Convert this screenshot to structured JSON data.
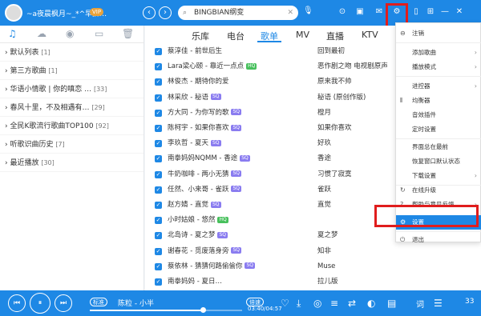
{
  "titlebar": {
    "username": "~a夜晨枫月~_*^早拼…",
    "vip": "VIP",
    "nav_back": "‹",
    "nav_forward": "›",
    "search_value": "BINGBIAN纲变",
    "icons": [
      "⊙",
      "▣",
      "✉",
      "⚙",
      "▯",
      "⊞",
      "—",
      "✕"
    ]
  },
  "left_tabs": [
    "♫",
    "☁",
    "◉",
    "▭",
    "🗑"
  ],
  "playlists": [
    {
      "label": "› 默认列表",
      "count": "[1]"
    },
    {
      "label": "› 第三方歌曲",
      "count": "[1]"
    },
    {
      "label": "› 华语小情歌 | 你的嗔恋 …",
      "count": "[33]"
    },
    {
      "label": "› 春风十里，不及相遇有…",
      "count": "[29]"
    },
    {
      "label": "› 全民K歌流行歌曲TOP100",
      "count": "[92]"
    },
    {
      "label": "› 听歌识曲历史",
      "count": "[7]"
    },
    {
      "label": "› 最近播放",
      "count": "[30]"
    }
  ],
  "tabs": [
    "乐库",
    "电台",
    "歌单",
    "MV",
    "直播",
    "KTV"
  ],
  "active_tab": 2,
  "songs": [
    {
      "title": "蔡淳佳 - 前世后生",
      "tag": "",
      "album": "回到最初"
    },
    {
      "title": "Lara梁心颐 - 靠近一点点",
      "tag": "HQ",
      "album": "恶作剧之吻 电视剧原声"
    },
    {
      "title": "林俊杰 - 期待你的爱",
      "tag": "",
      "album": "原来我不帅"
    },
    {
      "title": "林采欣 - 秘语",
      "tag": "SQ",
      "album": "秘语 (原创作版)"
    },
    {
      "title": "方大同 - 为你写的歌",
      "tag": "SQ",
      "album": "橙月"
    },
    {
      "title": "陈柯宇 - 如果你喜欢",
      "tag": "SQ",
      "album": "如果你喜欢"
    },
    {
      "title": "李玖哲 - 夏天",
      "tag": "SQ",
      "album": "好玖"
    },
    {
      "title": "南拳妈妈NQMM - 香途",
      "tag": "SQ",
      "album": "香途"
    },
    {
      "title": "牛奶咖啡 - 两小无猜",
      "tag": "SQ",
      "album": "习惯了寂寞"
    },
    {
      "title": "任然、小来哥 - 雀跃",
      "tag": "SQ",
      "album": "雀跃"
    },
    {
      "title": "赵方婧 - 直觉",
      "tag": "SQ",
      "album": "直觉"
    },
    {
      "title": "小时姑娘 - 悠然",
      "tag": "HQ",
      "album": ""
    },
    {
      "title": "北岛诗 - 夏之梦",
      "tag": "SQ",
      "album": "夏之梦"
    },
    {
      "title": "谢春花 - 觅废落身旁",
      "tag": "SQ",
      "album": "知非"
    },
    {
      "title": "蔡依林 - 猜猜何路偷偷你",
      "tag": "SQ",
      "album": "Muse"
    },
    {
      "title": "南拳妈妈 - 夏日…",
      "tag": "",
      "album": "拉儿版"
    }
  ],
  "menu": [
    {
      "icon": "⊖",
      "label": "注销",
      "arrow": ""
    },
    {
      "icon": "",
      "label": "添加歌曲",
      "arrow": "›"
    },
    {
      "icon": "",
      "label": "播放模式",
      "arrow": "›"
    },
    {
      "icon": "",
      "label": "进控器",
      "arrow": "›"
    },
    {
      "icon": "⫴",
      "label": "均衡器",
      "arrow": ""
    },
    {
      "icon": "",
      "label": "音效插件",
      "arrow": ""
    },
    {
      "icon": "",
      "label": "定时设置",
      "arrow": ""
    },
    {
      "icon": "",
      "label": "界面总在最前",
      "arrow": ""
    },
    {
      "icon": "",
      "label": "恢复窗口默认状态",
      "arrow": ""
    },
    {
      "icon": "",
      "label": "下载设置",
      "arrow": "›"
    },
    {
      "icon": "↻",
      "label": "在线升级",
      "arrow": ""
    },
    {
      "icon": "?",
      "label": "帮助与意见反馈",
      "arrow": "›"
    },
    {
      "icon": "⚙",
      "label": "设置",
      "arrow": ""
    },
    {
      "icon": "⏻",
      "label": "退出",
      "arrow": ""
    }
  ],
  "player": {
    "quality": "标准",
    "now_playing": "陈粒 - 小半",
    "lyric_mode": "倍速",
    "time": "03:40/04:57",
    "progress": 0.74,
    "lyric_label": "词",
    "queue_count": "33",
    "icons": [
      "♡",
      "⤓",
      "◎",
      "≡",
      "⇄",
      "◐",
      "▤"
    ]
  },
  "colors": {
    "accent": "#1e88e5",
    "highlight_box": "#e01d1d"
  }
}
